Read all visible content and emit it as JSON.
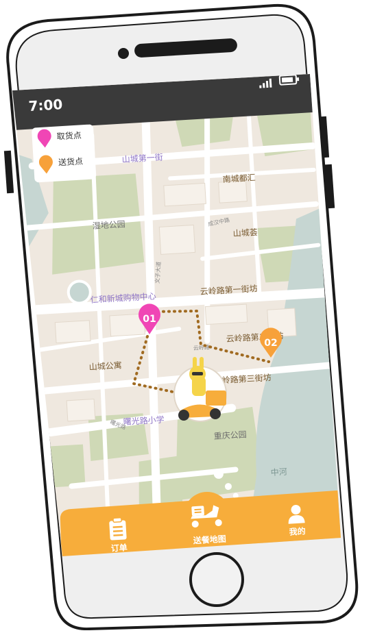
{
  "status_bar": {
    "time": "7:00"
  },
  "legend": [
    {
      "label": "取货点",
      "color": "#f046b5"
    },
    {
      "label": "送货点",
      "color": "#f7a13a"
    }
  ],
  "map": {
    "labels": {
      "shancheng_1st": "山城第一街",
      "nancheng": "南城都汇",
      "shidi_park": "湿地公园",
      "chenghan": "成汉中路",
      "shancheng_hui": "山城荟",
      "wenzi": "文子大道",
      "renhe_mall": "仁和新城购物中心",
      "yunling_1st": "云岭路第一街坊",
      "yunling_2nd": "云岭路第二街坊",
      "yunling_small": "云岭路",
      "shancheng_apt": "山城公寓",
      "yunling_3rd": "云岭路第三街坊",
      "shuguang_rd": "曙光路",
      "shuguang_school": "曙光路小学",
      "chongqing_park": "重庆公园",
      "zhonghe": "中河"
    },
    "pickup_marker": "01",
    "delivery_marker": "02"
  },
  "bottom_nav": {
    "orders": "订单",
    "map": "送餐地图",
    "mine": "我的"
  },
  "colors": {
    "accent": "#f7ad3b",
    "pickup": "#f046b5",
    "delivery": "#f7a13a",
    "route": "#a06a20"
  }
}
